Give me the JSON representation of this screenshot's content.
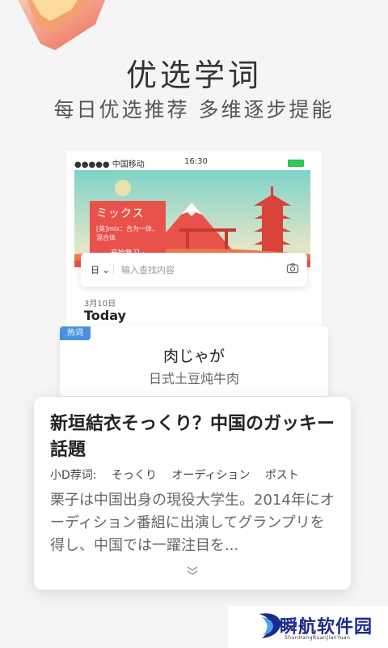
{
  "hero": {
    "title": "优选学词",
    "subtitle": "每日优选推荐  多维逐步提能"
  },
  "phone": {
    "carrier": "●●●●● 中国移动",
    "time": "16:30",
    "promo": {
      "word": "ミックス",
      "definition": "[英]mix：合为一体、混合体",
      "cta": "开始复习 ›"
    },
    "search": {
      "lang": "日",
      "placeholder": "输入查找内容",
      "camera_icon": "camera-icon"
    },
    "date": "3月10日",
    "today": "Today"
  },
  "hot_card": {
    "tag": "热词",
    "word": "肉じゃが",
    "meaning": "日式土豆炖牛肉"
  },
  "article": {
    "title": "新垣結衣そっくり？中国のガッキー話題",
    "tags_label": "小D荐词:",
    "tags": [
      "そっくり",
      "オーディション",
      "ポスト"
    ],
    "body": "栗子は中国出身の現役大学生。2014年にオーディション番組に出演してグランプリを得し、中国では一躍注目を...",
    "more_icon": "chevron-down-icon"
  },
  "watermark": {
    "text": "瞬航软件园",
    "sub": "ShunHangRuanJianYuan"
  },
  "colors": {
    "accent_red": "#e9524b",
    "tag_blue": "#4a90e2",
    "battery_green": "#34c759",
    "watermark_blue": "#1a2b8c"
  }
}
